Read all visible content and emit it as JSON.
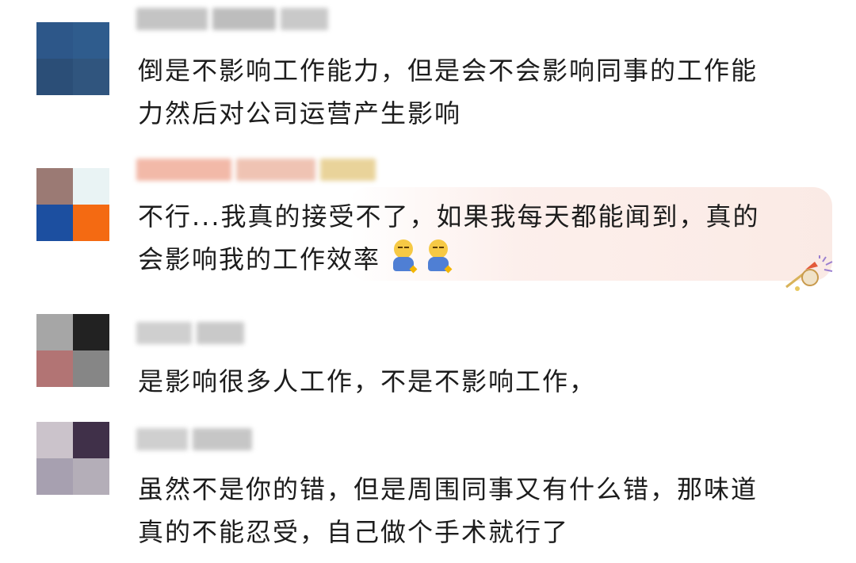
{
  "comments": [
    {
      "text_line1": "倒是不影响工作能力，但是会不会影响同事的工作能",
      "text_line2": "力然后对公司运营产生影响",
      "avatar_colors": [
        "#2d5789",
        "#2f5c8d",
        "#2b4e77",
        "#30557e"
      ],
      "username_colors": [
        "#c4c4c4",
        "#bdbdbd",
        "#c9c9c9"
      ]
    },
    {
      "text_line1": "不行...我真的接受不了，如果我每天都能闻到，真的",
      "text_line2": "会影响我的工作效率",
      "avatar_colors": [
        "#9b7a74",
        "#e9f3f4",
        "#1c4fa0",
        "#f46a12"
      ],
      "username_colors": [
        "#f2b9a8",
        "#efc3b3",
        "#e9d39a"
      ],
      "emoji_icons": [
        "smirk-person-icon",
        "smirk-person-icon"
      ]
    },
    {
      "text_line1": "是影响很多人工作，不是不影响工作，",
      "avatar_colors": [
        "#a6a6a6",
        "#222222",
        "#b27474",
        "#868686"
      ],
      "username_colors": [
        "#cfcfcf",
        "#c9c9c9"
      ]
    },
    {
      "text_line1": "虽然不是你的错，但是周围同事又有什么错，那味道",
      "text_line2": "真的不能忍受，自己做个手术就行了",
      "avatar_colors": [
        "#cbc3cb",
        "#403049",
        "#a7a0b0",
        "#b4aeb8"
      ],
      "username_colors": [
        "#cfcfcf",
        "#c6c6c6"
      ]
    }
  ],
  "colors": {
    "text": "#1c1c1c",
    "highlight_bubble": "#fbe9e4"
  }
}
